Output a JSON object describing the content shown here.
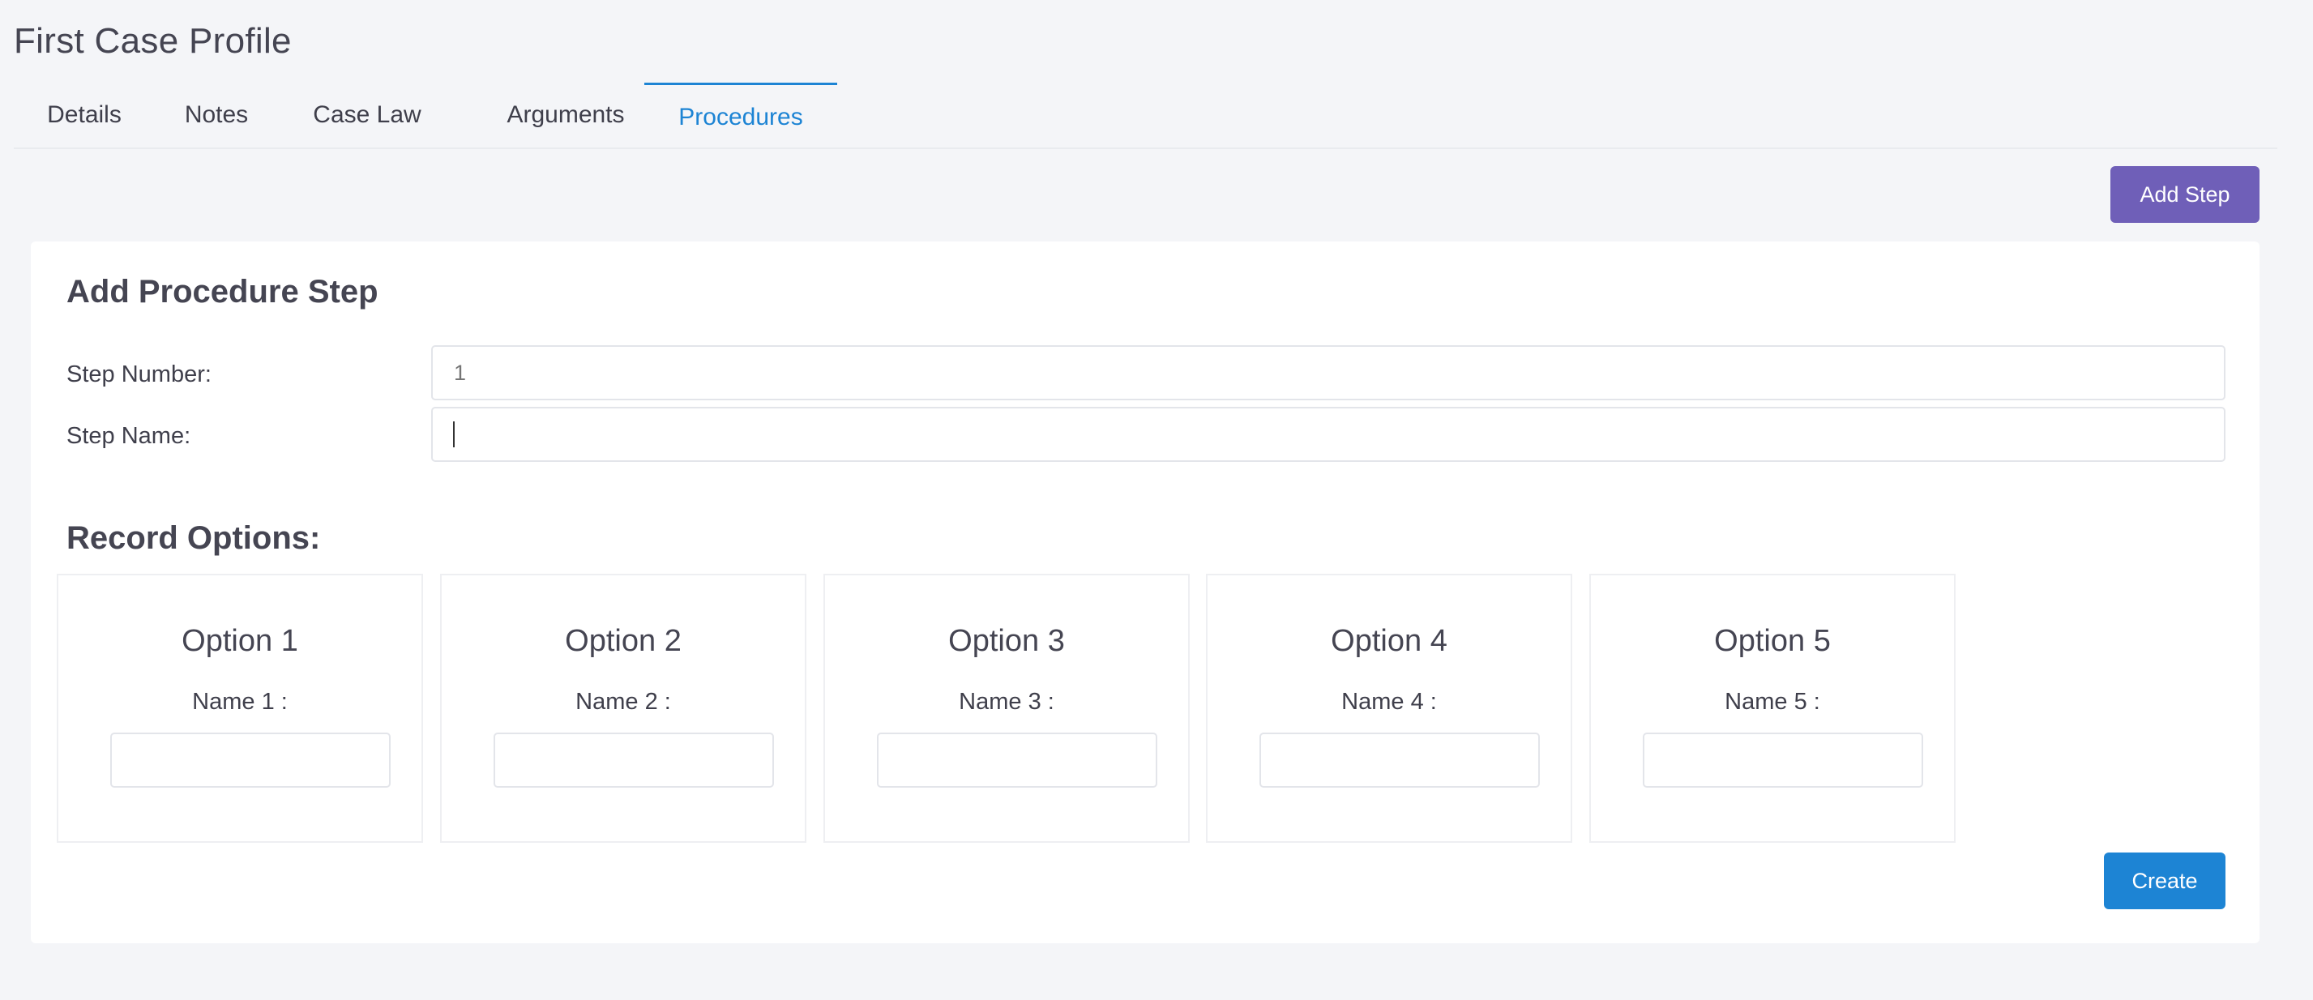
{
  "page": {
    "title": "First Case Profile"
  },
  "tabs": [
    {
      "label": "Details"
    },
    {
      "label": "Notes"
    },
    {
      "label": "Case Law"
    },
    {
      "label": "Arguments"
    },
    {
      "label": "Procedures",
      "active": true
    }
  ],
  "toolbar": {
    "add_step_label": "Add Step"
  },
  "form": {
    "title": "Add Procedure Step",
    "step_number_label": "Step Number:",
    "step_number_placeholder": "1",
    "step_name_label": "Step Name:",
    "step_name_value": "",
    "record_options_title": "Record Options:",
    "options": [
      {
        "title": "Option 1",
        "name_label": "Name 1 :",
        "value": ""
      },
      {
        "title": "Option 2",
        "name_label": "Name 2 :",
        "value": ""
      },
      {
        "title": "Option 3",
        "name_label": "Name 3 :",
        "value": ""
      },
      {
        "title": "Option 4",
        "name_label": "Name 4 :",
        "value": ""
      },
      {
        "title": "Option 5",
        "name_label": "Name 5 :",
        "value": ""
      }
    ],
    "create_label": "Create"
  },
  "colors": {
    "background": "#f4f5f8",
    "accent_blue": "#1d84d4",
    "accent_purple": "#6f5fb8",
    "text": "#3f3f4b"
  }
}
